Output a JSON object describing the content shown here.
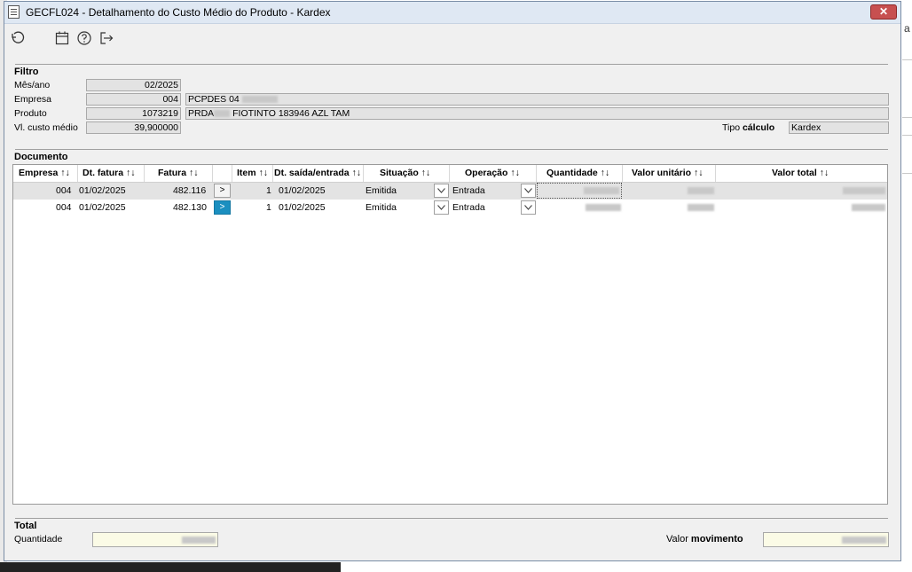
{
  "window": {
    "title": "GECFL024 - Detalhamento do Custo Médio do Produto - Kardex",
    "close_label": "✕"
  },
  "toolbar": {
    "icons": [
      "undo-icon",
      "calendar-icon",
      "help-icon",
      "exit-icon"
    ]
  },
  "background": {
    "right_char": "a"
  },
  "filtro": {
    "title": "Filtro",
    "mes_ano_label": "Mês/ano",
    "mes_ano_value": "02/2025",
    "empresa_label": "Empresa",
    "empresa_code": "004",
    "empresa_name": "PCPDES 04",
    "produto_label": "Produto",
    "produto_code": "1073219",
    "produto_name_prefix": "PRDA",
    "produto_name_suffix": "FIOTINTO 183946 AZL TAM",
    "vl_custo_label": "Vl. custo médio",
    "vl_custo_value": "39,900000",
    "tipo_calculo_label": "Tipo ",
    "tipo_calculo_label_bold": "cálculo",
    "tipo_calculo_value": "Kardex"
  },
  "documento": {
    "title": "Documento",
    "columns": {
      "empresa": "Empresa ↑↓",
      "dt_fatura": "Dt. fatura ↑↓",
      "fatura": "Fatura ↑↓",
      "item": "Item ↑↓",
      "dt_saida": "Dt. saída/entrada ↑↓",
      "situacao": "Situação ↑↓",
      "operacao": "Operação ↑↓",
      "quantidade": "Quantidade ↑↓",
      "valor_unitario": "Valor unitário ↑↓",
      "valor_total": "Valor total ↑↓"
    },
    "rows": [
      {
        "empresa": "004",
        "dt_fatura": "01/02/2025",
        "fatura": "482.116",
        "go": ">",
        "item": "1",
        "dt_saida": "01/02/2025",
        "situacao": "Emitida",
        "operacao": "Entrada"
      },
      {
        "empresa": "004",
        "dt_fatura": "01/02/2025",
        "fatura": "482.130",
        "go": ">",
        "item": "1",
        "dt_saida": "01/02/2025",
        "situacao": "Emitida",
        "operacao": "Entrada"
      }
    ]
  },
  "total": {
    "title": "Total",
    "quantidade_label": "Quantidade",
    "valor_movimento_label": "Valor ",
    "valor_movimento_label_bold": "movimento"
  },
  "colors": {
    "selected_go_button": "#1b8fc0",
    "total_field_bg": "#fbfbe6"
  }
}
